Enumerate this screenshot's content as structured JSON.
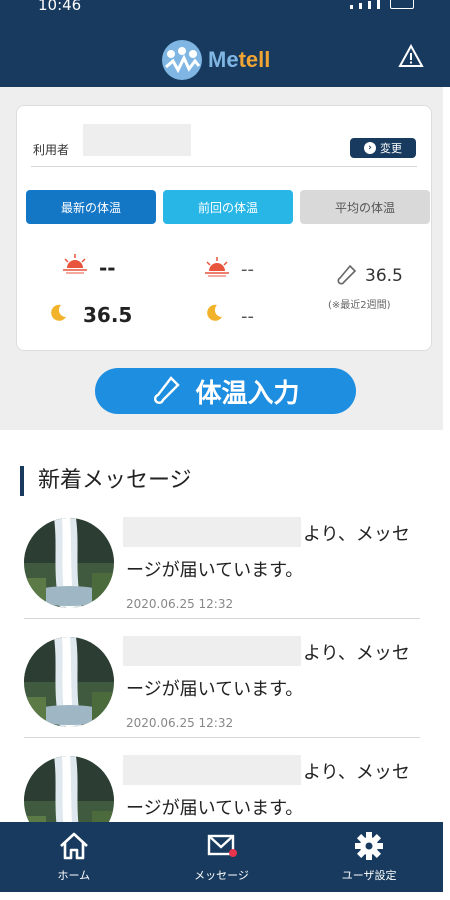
{
  "status": {
    "time": "10:46"
  },
  "app": {
    "logo_me": "Me",
    "logo_tell": "tell",
    "brand_color": "#173a5e",
    "accent_orange": "#f0a433"
  },
  "summary": {
    "user_label": "利用者",
    "change_label": "変更",
    "tabs": {
      "latest": "最新の体温",
      "previous": "前回の体温",
      "average": "平均の体温"
    },
    "latest": {
      "morning": "--",
      "night": "36.5"
    },
    "previous": {
      "morning": "--",
      "night": "--"
    },
    "average": {
      "value": "36.5",
      "note": "(※最近2週間)"
    },
    "input_button": "体温入力"
  },
  "messages": {
    "title": "新着メッセージ",
    "items": [
      {
        "text_line1": "より、メッセ",
        "text_line2": "ージが届いています。",
        "date": "2020.06.25  12:32"
      },
      {
        "text_line1": "より、メッセ",
        "text_line2": "ージが届いています。",
        "date": "2020.06.25  12:32"
      },
      {
        "text_line1": "より、メッセ",
        "text_line2": "ージが届いています。",
        "date": ""
      }
    ]
  },
  "nav": {
    "home": "ホーム",
    "message": "メッセージ",
    "settings": "ユーザ設定"
  },
  "icons": {
    "alert": "warning-triangle-icon",
    "thermometer": "thermometer-icon",
    "sun": "sun-icon",
    "moon": "moon-icon"
  }
}
